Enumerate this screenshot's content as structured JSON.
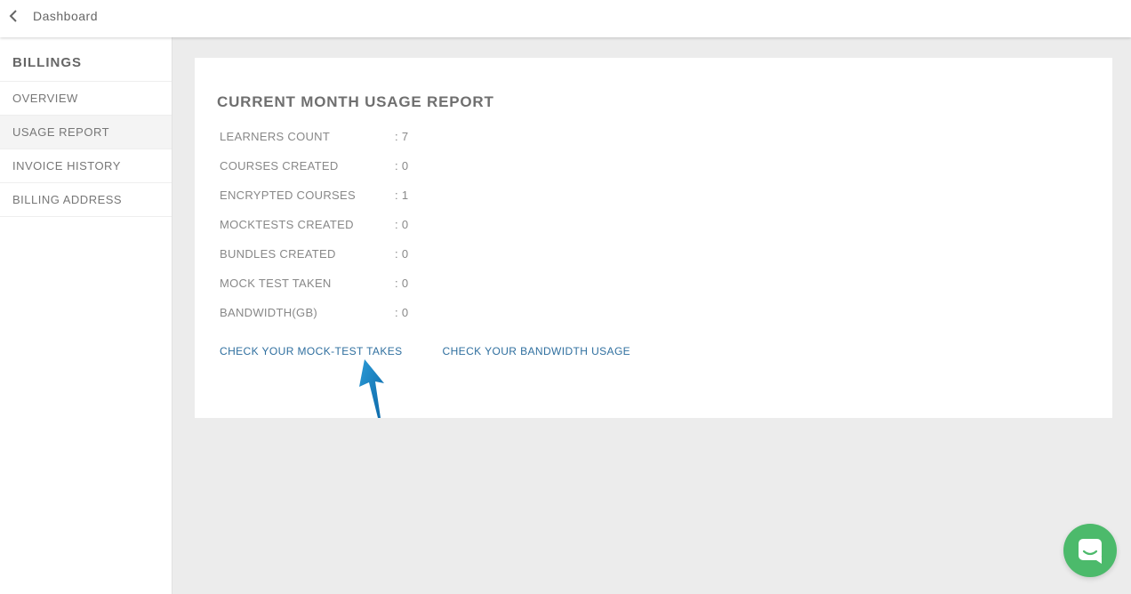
{
  "header": {
    "back_label": "Dashboard",
    "back_icon": "chevron-left-icon"
  },
  "sidebar": {
    "title": "BILLINGS",
    "items": [
      {
        "label": "OVERVIEW",
        "active": false
      },
      {
        "label": "USAGE REPORT",
        "active": true
      },
      {
        "label": "INVOICE HISTORY",
        "active": false
      },
      {
        "label": "BILLING ADDRESS",
        "active": false
      }
    ]
  },
  "report": {
    "title": "CURRENT MONTH USAGE REPORT",
    "rows": [
      {
        "label": "LEARNERS COUNT",
        "value": ": 7"
      },
      {
        "label": "COURSES CREATED",
        "value": ": 0"
      },
      {
        "label": "ENCRYPTED COURSES",
        "value": ": 1"
      },
      {
        "label": "MOCKTESTS CREATED",
        "value": ": 0"
      },
      {
        "label": "BUNDLES CREATED",
        "value": ": 0"
      },
      {
        "label": "MOCK TEST TAKEN",
        "value": ": 0"
      },
      {
        "label": "BANDWIDTH(GB)",
        "value": ": 0"
      }
    ],
    "links": {
      "mock_test_takes": "CHECK YOUR MOCK-TEST TAKES",
      "bandwidth_usage": "CHECK YOUR BANDWIDTH USAGE"
    }
  },
  "chat": {
    "icon": "chat-icon"
  },
  "colors": {
    "background": "#ececec",
    "link": "#2f6f9f",
    "chat_button": "#4cba6b",
    "annotation_arrow": "#1a7fc0"
  }
}
